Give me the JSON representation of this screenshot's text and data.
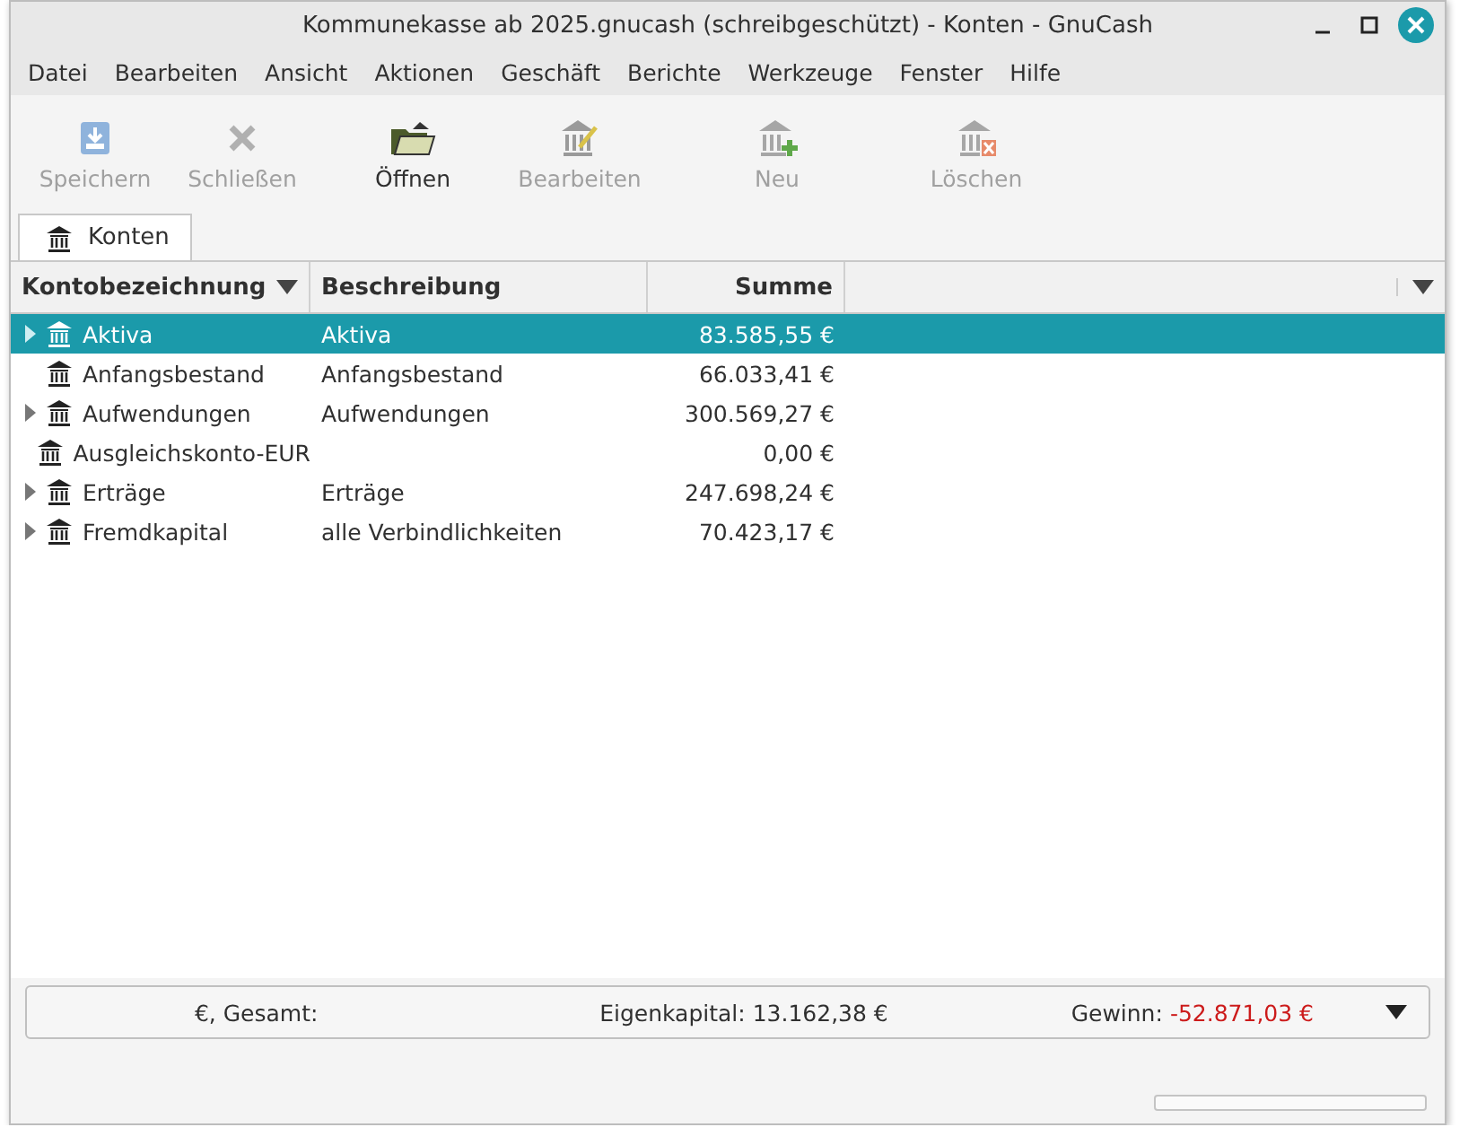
{
  "window": {
    "title": "Kommunekasse ab 2025.gnucash (schreibgeschützt) - Konten - GnuCash"
  },
  "menu": [
    "Datei",
    "Bearbeiten",
    "Ansicht",
    "Aktionen",
    "Geschäft",
    "Berichte",
    "Werkzeuge",
    "Fenster",
    "Hilfe"
  ],
  "toolbar": [
    {
      "label": "Speichern",
      "kind": "save",
      "disabled": true
    },
    {
      "label": "Schließen",
      "kind": "close",
      "disabled": true
    },
    {
      "label": "Öffnen",
      "kind": "open",
      "disabled": false
    },
    {
      "label": "Bearbeiten",
      "kind": "edit",
      "disabled": true
    },
    {
      "label": "Neu",
      "kind": "new",
      "disabled": true
    },
    {
      "label": "Löschen",
      "kind": "delete",
      "disabled": true
    }
  ],
  "tabs": [
    {
      "label": "Konten",
      "selected": true
    }
  ],
  "table": {
    "columns": [
      "Kontobezeichnung",
      "Beschreibung",
      "Summe"
    ],
    "rows": [
      {
        "name": "Aktiva",
        "description": "Aktiva",
        "total": "83.585,55 €",
        "expandable": true,
        "selected": true
      },
      {
        "name": "Anfangsbestand",
        "description": "Anfangsbestand",
        "total": "66.033,41 €",
        "expandable": false,
        "selected": false
      },
      {
        "name": "Aufwendungen",
        "description": "Aufwendungen",
        "total": "300.569,27 €",
        "expandable": true,
        "selected": false
      },
      {
        "name": "Ausgleichskonto-EUR",
        "description": "",
        "total": "0,00 €",
        "expandable": false,
        "selected": false
      },
      {
        "name": "Erträge",
        "description": "Erträge",
        "total": "247.698,24 €",
        "expandable": true,
        "selected": false
      },
      {
        "name": "Fremdkapital",
        "description": "alle Verbindlichkeiten",
        "total": "70.423,17 €",
        "expandable": true,
        "selected": false
      }
    ]
  },
  "summary": {
    "currency": "€, Gesamt:",
    "equity": "Eigenkapital: 13.162,38 €",
    "profit_label": "Gewinn:",
    "profit": "-52.871,03 €",
    "profit_negative": true
  },
  "status_bar": {
    "progress": {
      "level": 0
    }
  }
}
